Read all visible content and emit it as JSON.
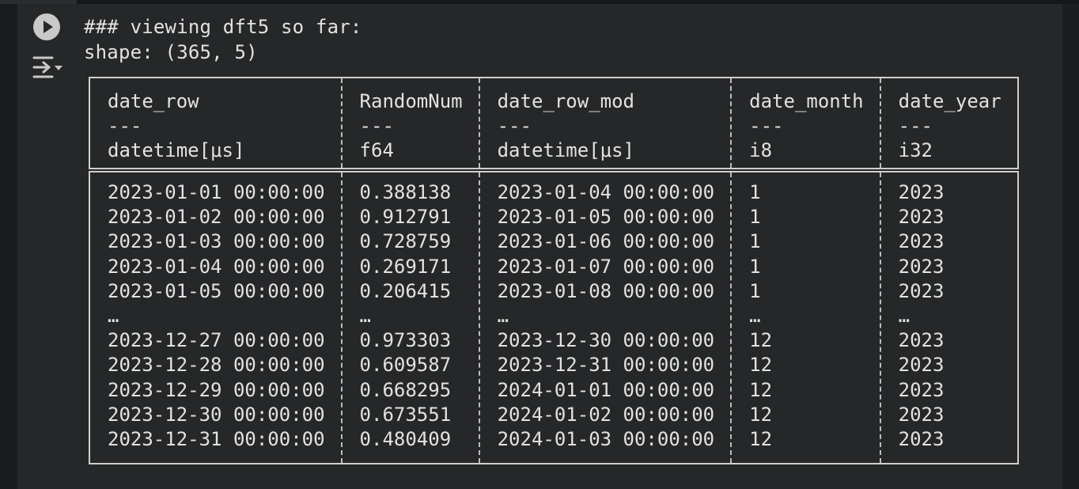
{
  "cell": {
    "output_lines": [
      "### viewing dft5 so far:",
      "shape: (365, 5)"
    ]
  },
  "table": {
    "columns": [
      {
        "name": "date_row",
        "sep": "---",
        "dtype": "datetime[μs]"
      },
      {
        "name": "RandomNum",
        "sep": "---",
        "dtype": "f64"
      },
      {
        "name": "date_row_mod",
        "sep": "---",
        "dtype": "datetime[μs]"
      },
      {
        "name": "date_month",
        "sep": "---",
        "dtype": "i8"
      },
      {
        "name": "date_year",
        "sep": "---",
        "dtype": "i32"
      }
    ],
    "rows": [
      [
        "2023-01-01 00:00:00",
        "0.388138",
        "2023-01-04 00:00:00",
        "1",
        "2023"
      ],
      [
        "2023-01-02 00:00:00",
        "0.912791",
        "2023-01-05 00:00:00",
        "1",
        "2023"
      ],
      [
        "2023-01-03 00:00:00",
        "0.728759",
        "2023-01-06 00:00:00",
        "1",
        "2023"
      ],
      [
        "2023-01-04 00:00:00",
        "0.269171",
        "2023-01-07 00:00:00",
        "1",
        "2023"
      ],
      [
        "2023-01-05 00:00:00",
        "0.206415",
        "2023-01-08 00:00:00",
        "1",
        "2023"
      ],
      [
        "…",
        "…",
        "…",
        "…",
        "…"
      ],
      [
        "2023-12-27 00:00:00",
        "0.973303",
        "2023-12-30 00:00:00",
        "12",
        "2023"
      ],
      [
        "2023-12-28 00:00:00",
        "0.609587",
        "2023-12-31 00:00:00",
        "12",
        "2023"
      ],
      [
        "2023-12-29 00:00:00",
        "0.668295",
        "2024-01-01 00:00:00",
        "12",
        "2023"
      ],
      [
        "2023-12-30 00:00:00",
        "0.673551",
        "2024-01-02 00:00:00",
        "12",
        "2023"
      ],
      [
        "2023-12-31 00:00:00",
        "0.480409",
        "2024-01-03 00:00:00",
        "12",
        "2023"
      ]
    ]
  },
  "icons": {
    "run": "play-circle-icon",
    "output": "output-actions-icon"
  },
  "colors": {
    "background": "#252728",
    "text": "#e2e2e2",
    "border": "#cfcfcf"
  }
}
